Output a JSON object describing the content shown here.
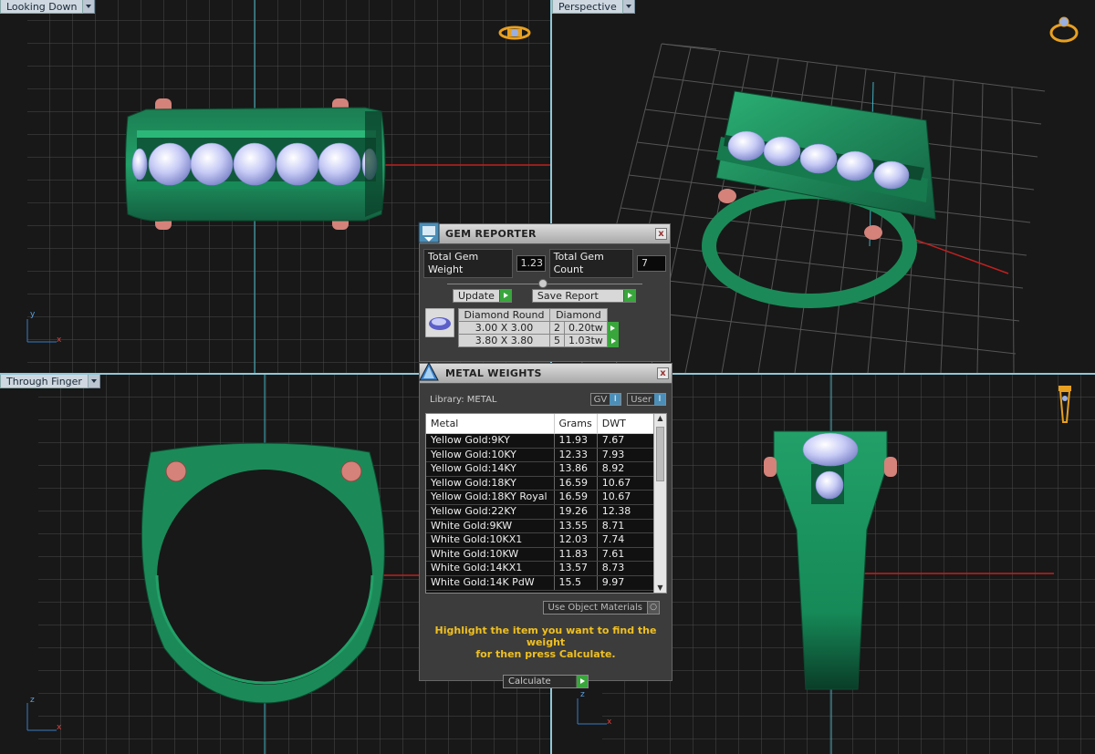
{
  "viewports": {
    "top_left": {
      "label": "Looking Down"
    },
    "top_right": {
      "label": "Perspective"
    },
    "bottom_left": {
      "label": "Through Finger"
    },
    "bottom_right": {
      "label": ""
    }
  },
  "axes": {
    "y": "y",
    "x": "x",
    "z": "z"
  },
  "gem_reporter": {
    "title": "GEM REPORTER",
    "close": "x",
    "total_weight_label": "Total Gem Weight",
    "total_weight_value": "1.23",
    "total_count_label": "Total Gem Count",
    "total_count_value": "7",
    "update_label": "Update",
    "save_report_label": "Save Report",
    "headers": [
      "Diamond Round",
      "Diamond"
    ],
    "rows": [
      {
        "size": "3.00 X 3.00",
        "count": "2",
        "weight": "0.20tw"
      },
      {
        "size": "3.80 X 3.80",
        "count": "5",
        "weight": "1.03tw"
      }
    ]
  },
  "metal_weights": {
    "title": "METAL WEIGHTS",
    "close": "x",
    "library_label": "Library: METAL",
    "gv_label": "GV",
    "user_label": "User",
    "columns": [
      "Metal",
      "Grams",
      "DWT"
    ],
    "rows": [
      [
        "Yellow Gold:9KY",
        "11.93",
        "7.67"
      ],
      [
        "Yellow Gold:10KY",
        "12.33",
        "7.93"
      ],
      [
        "Yellow Gold:14KY",
        "13.86",
        "8.92"
      ],
      [
        "Yellow Gold:18KY",
        "16.59",
        "10.67"
      ],
      [
        "Yellow Gold:18KY Royal",
        "16.59",
        "10.67"
      ],
      [
        "Yellow Gold:22KY",
        "19.26",
        "12.38"
      ],
      [
        "White Gold:9KW",
        "13.55",
        "8.71"
      ],
      [
        "White Gold:10KX1",
        "12.03",
        "7.74"
      ],
      [
        "White Gold:10KW",
        "11.83",
        "7.61"
      ],
      [
        "White Gold:14KX1",
        "13.57",
        "8.73"
      ],
      [
        "White Gold:14K PdW",
        "15.5",
        "9.97"
      ]
    ],
    "use_object_materials": "Use Object Materials",
    "hint_line1": "Highlight the item you want to find the weight",
    "hint_line2": "for then press Calculate.",
    "calculate_label": "Calculate"
  },
  "colors": {
    "ring_green": "#1e8a5a",
    "ring_dark": "#0f5a3a",
    "prong_pink": "#d4827a",
    "gem_blue": "#c8d0f8",
    "axis_red": "#c02020",
    "axis_cyan": "#40b0c0",
    "highlight_yellow": "#f0c020",
    "button_green": "#39a63c"
  }
}
